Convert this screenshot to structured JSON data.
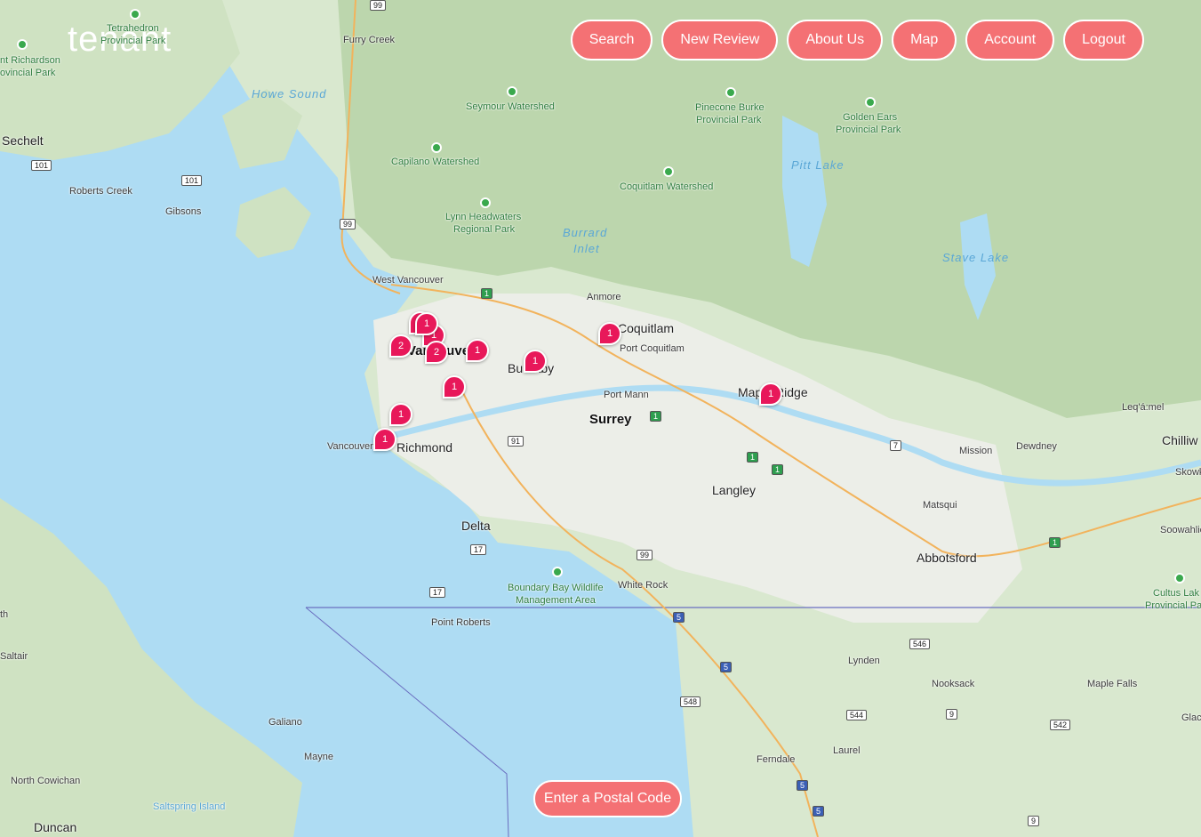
{
  "brand": {
    "logo": "tenant"
  },
  "nav": {
    "search": "Search",
    "new_review": "New Review",
    "about": "About Us",
    "map": "Map",
    "account": "Account",
    "logout": "Logout"
  },
  "postal_button": "Enter a Postal Code",
  "markers": [
    "1",
    "1",
    "2",
    "1",
    "2",
    "1",
    "1",
    "1",
    "1",
    "1",
    "1",
    "1"
  ],
  "labels": {
    "tetrahedron": "Tetrahedron",
    "tetrahedron_park": "Provincial Park",
    "richardson": "nt Richardson",
    "richardson_park": "ovincial Park",
    "furry_creek": "Furry Creek",
    "howe_sound": "Howe Sound",
    "seymour": "Seymour Watershed",
    "pinecone": "Pinecone Burke",
    "pinecone_park": "Provincial Park",
    "golden_ears": "Golden Ears",
    "golden_ears_park": "Provincial Park",
    "sechelt": "Sechelt",
    "capilano": "Capilano Watershed",
    "pitt_lake": "Pitt Lake",
    "coquitlam_ws": "Coquitlam Watershed",
    "roberts_creek": "Roberts Creek",
    "gibsons": "Gibsons",
    "lynn": "Lynn Headwaters",
    "lynn_park": "Regional Park",
    "burrard": "Burrard",
    "inlet": "Inlet",
    "stave_lake": "Stave Lake",
    "west_vancouver": "West Vancouver",
    "anmore": "Anmore",
    "coquitlam": "Coquitlam",
    "port_coquitlam": "Port Coquitlam",
    "vancouver_city": "Vancouver",
    "burnaby": "Burnaby",
    "port_mann": "Port Mann",
    "maple_ridge": "Maple Ridge",
    "surrey": "Surrey",
    "leqamel": "Leq'á:mel",
    "vancouver_airport": "Vancouver",
    "richmond": "Richmond",
    "mission": "Mission",
    "dewdney": "Dewdney",
    "chilliwack": "Chilliw",
    "skowkale": "Skowk",
    "langley": "Langley",
    "matsqui": "Matsqui",
    "delta": "Delta",
    "soowahlie": "Soowahlie",
    "abbotsford": "Abbotsford",
    "boundary_bay": "Boundary Bay Wildlife",
    "boundary_bay2": "Management Area",
    "white_rock": "White Rock",
    "cultus": "Cultus Lak",
    "cultus2": "Provincial Pa",
    "th": "th",
    "point_roberts": "Point Roberts",
    "saltair": "Saltair",
    "lynden": "Lynden",
    "nooksack": "Nooksack",
    "maple_falls": "Maple Falls",
    "glaci": "Glaci",
    "galiano": "Galiano",
    "mayne": "Mayne",
    "ferndale": "Ferndale",
    "laurel": "Laurel",
    "north_cowichan": "North Cowichan",
    "saltspring": "Saltspring Island",
    "duncan": "Duncan"
  },
  "shields": [
    "99",
    "101",
    "101",
    "99",
    "1",
    "91",
    "1",
    "7",
    "1",
    "1",
    "17",
    "99",
    "17",
    "5",
    "1",
    "5",
    "546",
    "548",
    "544",
    "9",
    "542",
    "5",
    "5",
    "9"
  ],
  "colors": {
    "accent": "#f47174",
    "marker": "#e8185a",
    "water": "#aedcf3",
    "land": "#e6eee0",
    "forest": "#bcd9b0"
  }
}
